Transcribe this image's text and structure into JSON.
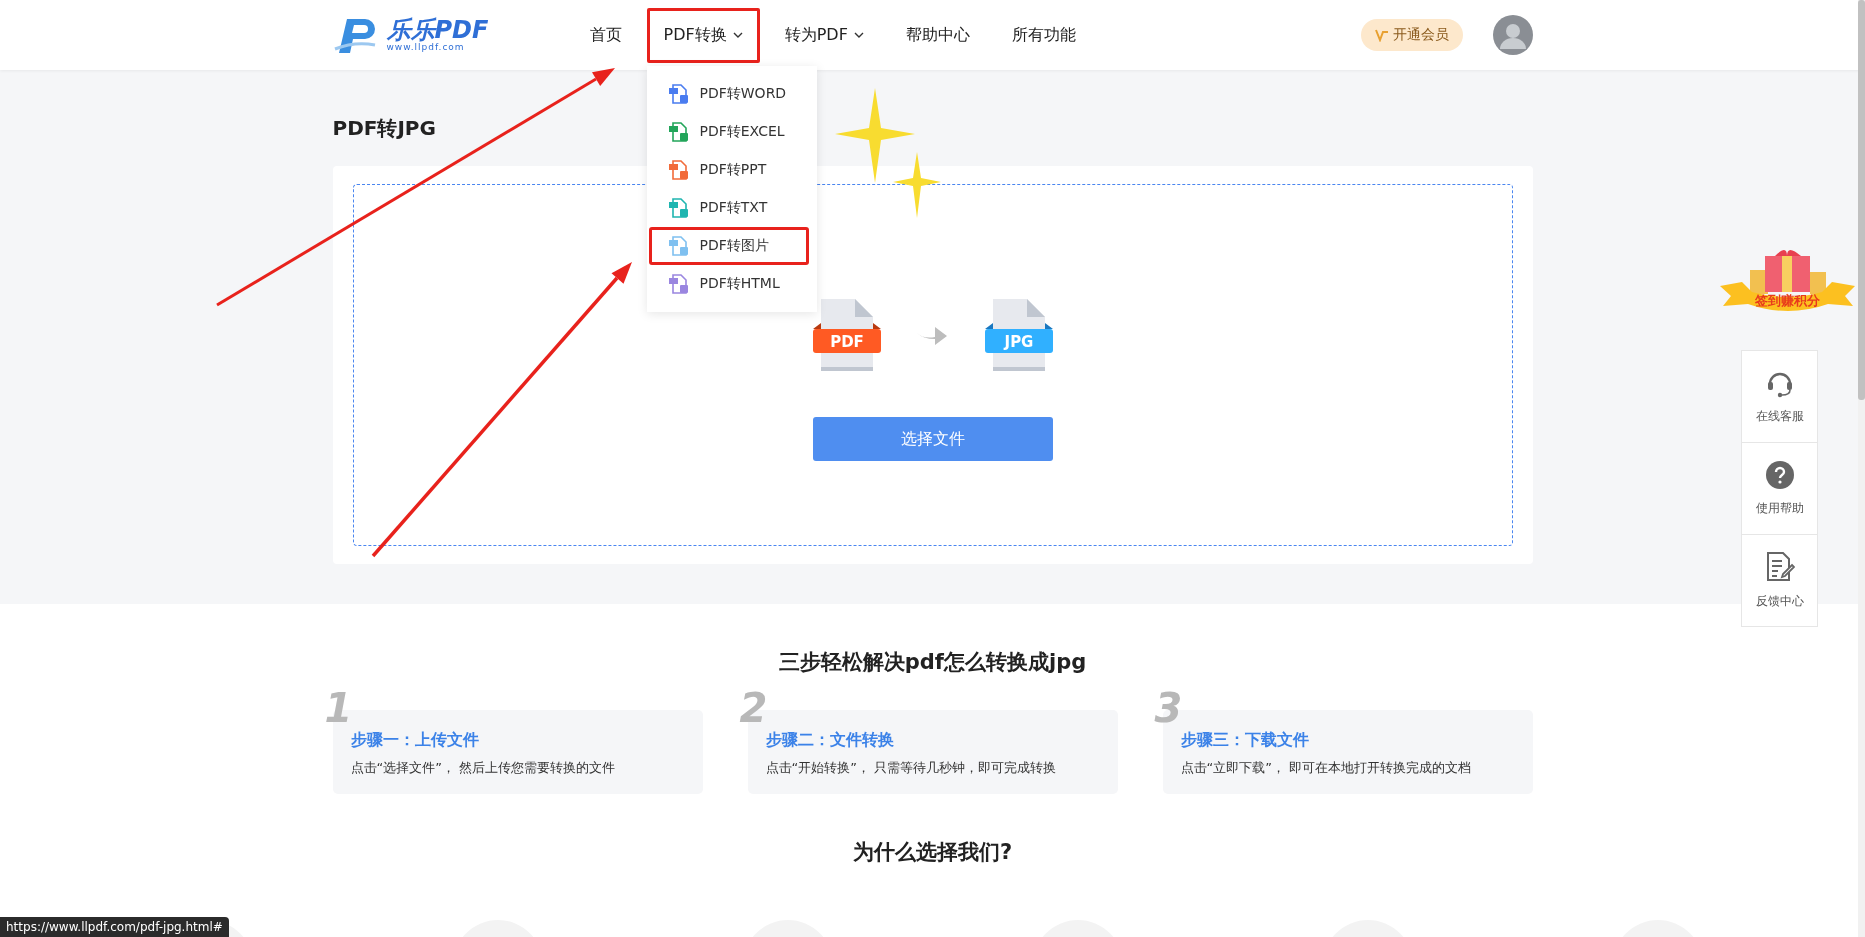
{
  "logo": {
    "name": "乐乐PDF",
    "url": "www.llpdf.com"
  },
  "nav": [
    {
      "label": "首页",
      "has_caret": false,
      "expanded": false,
      "annotated": false
    },
    {
      "label": "PDF转换",
      "has_caret": true,
      "expanded": true,
      "annotated": true
    },
    {
      "label": "转为PDF",
      "has_caret": true,
      "expanded": false,
      "annotated": false
    },
    {
      "label": "帮助中心",
      "has_caret": false,
      "expanded": false,
      "annotated": false
    },
    {
      "label": "所有功能",
      "has_caret": false,
      "expanded": false,
      "annotated": false
    }
  ],
  "vip_button": "开通会员",
  "dropdown": [
    {
      "label": "PDF转WORD",
      "color": "#4a7cf0",
      "annotated": false
    },
    {
      "label": "PDF转EXCEL",
      "color": "#22a55a",
      "annotated": false
    },
    {
      "label": "PDF转PPT",
      "color": "#f26b3a",
      "annotated": false
    },
    {
      "label": "PDF转TXT",
      "color": "#1fb5b0",
      "annotated": false
    },
    {
      "label": "PDF转图片",
      "color": "#7fc0f0",
      "annotated": true
    },
    {
      "label": "PDF转HTML",
      "color": "#9a86e0",
      "annotated": false
    }
  ],
  "page_title": "PDF转JPG",
  "converter": {
    "from": "PDF",
    "to": "JPG",
    "button": "选择文件"
  },
  "gift_badge": "签到赚积分",
  "side_tools": [
    {
      "kind": "headset",
      "label": "在线客服"
    },
    {
      "kind": "help",
      "label": "使用帮助"
    },
    {
      "kind": "feedback",
      "label": "反馈中心"
    }
  ],
  "steps_title": "三步轻松解决pdf怎么转换成jpg",
  "steps": [
    {
      "number": "1",
      "title": "步骤一：上传文件",
      "text": "点击“选择文件”， 然后上传您需要转换的文件"
    },
    {
      "number": "2",
      "title": "步骤二：文件转换",
      "text": "点击“开始转换”， 只需等待几秒钟，即可完成转换"
    },
    {
      "number": "3",
      "title": "步骤三：下载文件",
      "text": "点击“立即下载”， 即可在本地打开转换完成的文档"
    }
  ],
  "why_title": "为什么选择我们?",
  "status_url": "https://www.llpdf.com/pdf-jpg.html#"
}
